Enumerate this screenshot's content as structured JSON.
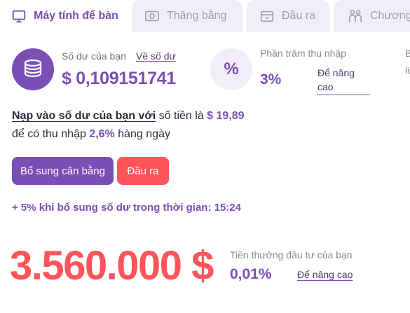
{
  "tabs": [
    {
      "label": "Máy tính để bàn",
      "icon": "desktop-icon",
      "active": true
    },
    {
      "label": "Thăng bằng",
      "icon": "balance-icon",
      "active": false
    },
    {
      "label": "Đầu ra",
      "icon": "wallet-icon",
      "active": false
    },
    {
      "label": "Chương",
      "icon": "people-icon",
      "active": false
    }
  ],
  "balance": {
    "label": "Số dư của bạn",
    "link": "Về số dư",
    "value": "$ 0,109151741",
    "icon": "coins-icon"
  },
  "income": {
    "label": "Phần trăm thu nhập",
    "value": "3%",
    "upgrade": "Để nâng cao",
    "icon_symbol": "%",
    "truncated_label": "B",
    "truncated_value": "lú"
  },
  "deposit_info": {
    "underlined": "Nạp vào số dư của bạn với",
    "middle": " số tiền là ",
    "amount": "$ 19,89",
    "line2_start": "để có thu nhập ",
    "rate": "2,6%",
    "line2_end": " hàng ngày"
  },
  "buttons": {
    "topup": "Bổ sung cân bằng",
    "withdraw": "Đầu ra"
  },
  "bonus_line": "+ 5% khi bổ sung số dư trong thời gian: 15:24",
  "invest": {
    "amount": "3.560.000 $",
    "label": "Tiền thưởng đầu tư của bạn",
    "rate": "0,01%",
    "upgrade": "Để nâng cao"
  },
  "colors": {
    "purple": "#7a4fb5",
    "red": "#ff5459",
    "tab_inactive_bg": "#f1eef7"
  }
}
